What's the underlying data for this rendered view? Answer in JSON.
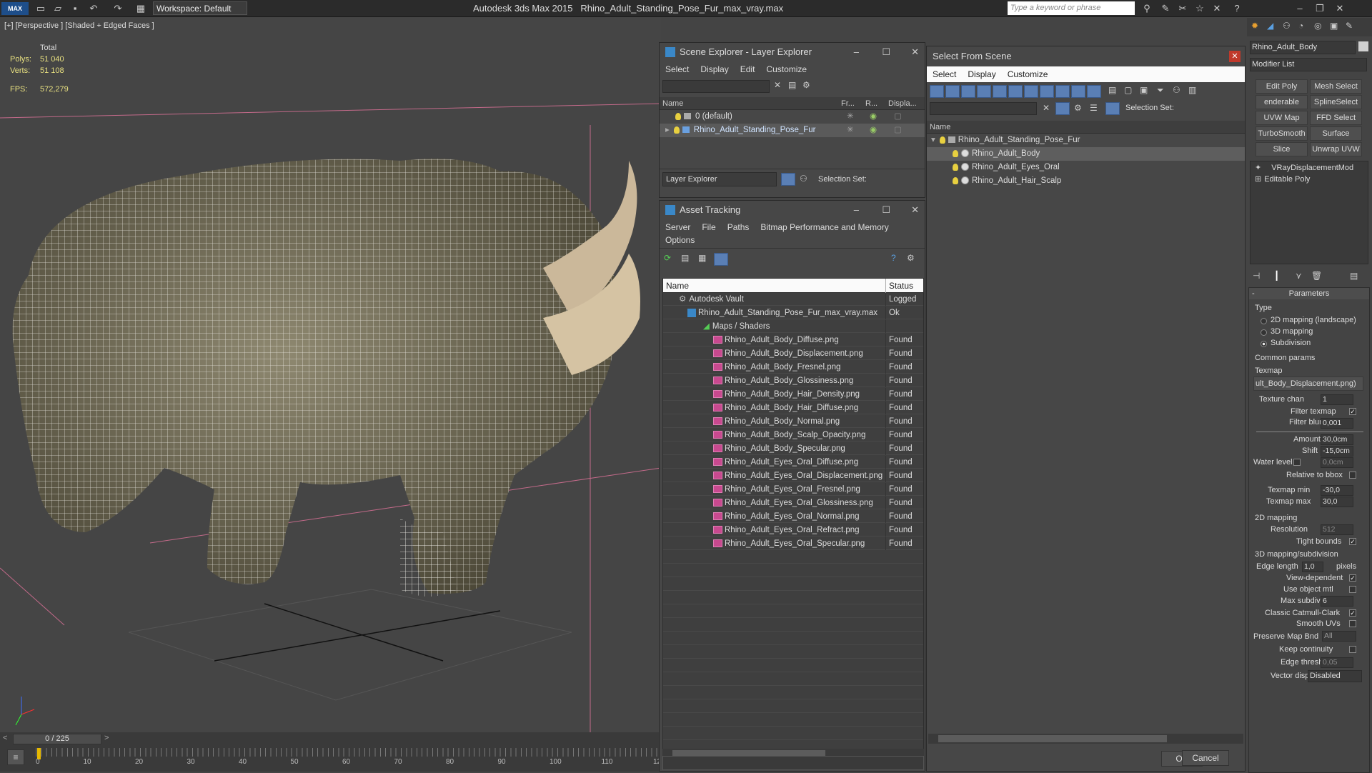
{
  "titlebar": {
    "logo": "MAX",
    "workspace": "Workspace: Default",
    "app": "Autodesk 3ds Max  2015",
    "file": "Rhino_Adult_Standing_Pose_Fur_max_vray.max",
    "search_placeholder": "Type a keyword or phrase"
  },
  "viewport": {
    "label": "[+] [Perspective ] [Shaded + Edged Faces ]",
    "stats": {
      "total": "Total",
      "polys_label": "Polys:",
      "polys": "51 040",
      "verts_label": "Verts:",
      "verts": "51 108",
      "fps_label": "FPS:",
      "fps": "572,279"
    }
  },
  "timeline": {
    "frame": "0 / 225",
    "ticks": [
      "0",
      "10",
      "20",
      "30",
      "40",
      "50",
      "60",
      "70",
      "80",
      "90",
      "100",
      "110",
      "12"
    ]
  },
  "scene_explorer": {
    "title": "Scene Explorer - Layer Explorer",
    "menu": [
      "Select",
      "Display",
      "Edit",
      "Customize"
    ],
    "cols": [
      "Name",
      "Fr...",
      "R...",
      "Displa..."
    ],
    "rows": [
      "0 (default)",
      "Rhino_Adult_Standing_Pose_Fur"
    ],
    "footer": "Layer Explorer",
    "selset": "Selection Set:"
  },
  "asset_tracking": {
    "title": "Asset Tracking",
    "menu": [
      "Server",
      "File",
      "Paths",
      "Bitmap Performance and Memory",
      "Options"
    ],
    "cols": [
      "Name",
      "Status"
    ],
    "rows": [
      {
        "name": "Autodesk Vault",
        "status": "Logged",
        "indent": 1
      },
      {
        "name": "Rhino_Adult_Standing_Pose_Fur_max_vray.max",
        "status": "Ok",
        "indent": 2
      },
      {
        "name": "Maps / Shaders",
        "status": "",
        "indent": 3
      },
      {
        "name": "Rhino_Adult_Body_Diffuse.png",
        "status": "Found",
        "indent": 4
      },
      {
        "name": "Rhino_Adult_Body_Displacement.png",
        "status": "Found",
        "indent": 4
      },
      {
        "name": "Rhino_Adult_Body_Fresnel.png",
        "status": "Found",
        "indent": 4
      },
      {
        "name": "Rhino_Adult_Body_Glossiness.png",
        "status": "Found",
        "indent": 4
      },
      {
        "name": "Rhino_Adult_Body_Hair_Density.png",
        "status": "Found",
        "indent": 4
      },
      {
        "name": "Rhino_Adult_Body_Hair_Diffuse.png",
        "status": "Found",
        "indent": 4
      },
      {
        "name": "Rhino_Adult_Body_Normal.png",
        "status": "Found",
        "indent": 4
      },
      {
        "name": "Rhino_Adult_Body_Scalp_Opacity.png",
        "status": "Found",
        "indent": 4
      },
      {
        "name": "Rhino_Adult_Body_Specular.png",
        "status": "Found",
        "indent": 4
      },
      {
        "name": "Rhino_Adult_Eyes_Oral_Diffuse.png",
        "status": "Found",
        "indent": 4
      },
      {
        "name": "Rhino_Adult_Eyes_Oral_Displacement.png",
        "status": "Found",
        "indent": 4
      },
      {
        "name": "Rhino_Adult_Eyes_Oral_Fresnel.png",
        "status": "Found",
        "indent": 4
      },
      {
        "name": "Rhino_Adult_Eyes_Oral_Glossiness.png",
        "status": "Found",
        "indent": 4
      },
      {
        "name": "Rhino_Adult_Eyes_Oral_Normal.png",
        "status": "Found",
        "indent": 4
      },
      {
        "name": "Rhino_Adult_Eyes_Oral_Refract.png",
        "status": "Found",
        "indent": 4
      },
      {
        "name": "Rhino_Adult_Eyes_Oral_Specular.png",
        "status": "Found",
        "indent": 4
      }
    ]
  },
  "select_from_scene": {
    "title": "Select From Scene",
    "menu": [
      "Select",
      "Display",
      "Customize"
    ],
    "selset": "Selection Set:",
    "col": "Name",
    "root": "Rhino_Adult_Standing_Pose_Fur",
    "items": [
      "Rhino_Adult_Body",
      "Rhino_Adult_Eyes_Oral",
      "Rhino_Adult_Hair_Scalp"
    ],
    "ok": "OK",
    "cancel": "Cancel"
  },
  "command_panel": {
    "object_name": "Rhino_Adult_Body",
    "modifier_list": "Modifier List",
    "buttons": [
      "Edit Poly",
      "Mesh Select",
      "enderable Splir",
      "SplineSelect",
      "UVW Map",
      "FFD Select",
      "TurboSmooth",
      "Surface Select",
      "Slice",
      "Unwrap UVW"
    ],
    "stack": [
      "VRayDisplacementMod",
      "Editable Poly"
    ],
    "params": {
      "title": "Parameters",
      "type": "Type",
      "r1": "2D mapping (landscape)",
      "r2": "3D mapping",
      "r3": "Subdivision",
      "common": "Common params",
      "texmap": "Texmap",
      "texmap_val": "ult_Body_Displacement.png)",
      "texchan": "Texture chan",
      "texchan_v": "1",
      "filter_texmap": "Filter texmap",
      "filter_blur": "Filter blur",
      "filter_blur_v": "0,001",
      "amount": "Amount",
      "amount_v": "30,0cm",
      "shift": "Shift",
      "shift_v": "-15,0cm",
      "water": "Water level",
      "water_v": "0,0cm",
      "rel": "Relative to bbox",
      "tmin": "Texmap min",
      "tmin_v": "-30,0",
      "tmax": "Texmap max",
      "tmax_v": "30,0",
      "map2d": "2D mapping",
      "res": "Resolution",
      "res_v": "512",
      "tight": "Tight bounds",
      "map3d": "3D mapping/subdivision",
      "edge": "Edge length",
      "edge_v": "1,0",
      "pixels": "pixels",
      "viewdep": "View-dependent",
      "useobj": "Use object mtl",
      "maxsub": "Max subdivs",
      "maxsub_v": "6",
      "catmull": "Classic Catmull-Clark",
      "smooth": "Smooth UVs",
      "pmb": "Preserve Map Bnd",
      "pmb_v": "All",
      "keep": "Keep continuity",
      "ethresh": "Edge thresh",
      "ethresh_v": "0,05",
      "vdisp": "Vector displ",
      "vdisp_v": "Disabled"
    }
  }
}
